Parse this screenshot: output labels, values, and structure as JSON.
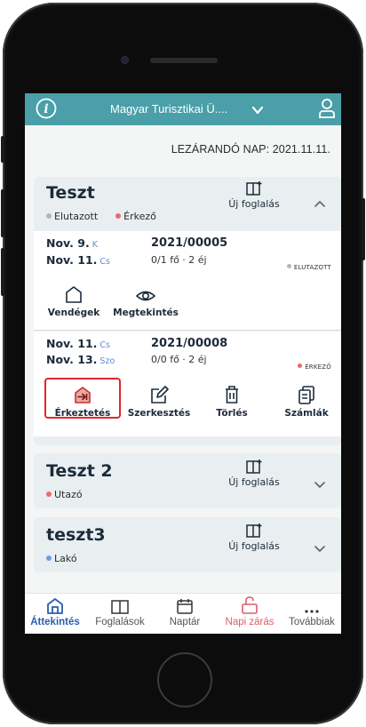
{
  "header": {
    "title": "Magyar Turisztikai Ü....",
    "info_icon": "info-circle-icon",
    "user_icon": "user-icon",
    "accent": "#4a9fa9"
  },
  "close_day": "LEZÁRANDÓ NAP: 2021.11.11.",
  "cards": [
    {
      "title": "Teszt",
      "legend": [
        {
          "label": "Elutazott",
          "color": "#b5b5b5"
        },
        {
          "label": "Érkező",
          "color": "#e76a74"
        }
      ],
      "new_booking": "Új foglalás",
      "expanded": true,
      "bookings": [
        {
          "date1": "Nov. 9.",
          "day1": "K",
          "date2": "Nov. 11.",
          "day2": "Cs",
          "number": "2021/00005",
          "guests": "0/1 fő · 2 éj",
          "status": "ELUTAZOTT",
          "status_color": "#b5b5b5",
          "actions": [
            {
              "label": "Vendégek",
              "icon": "house-icon"
            },
            {
              "label": "Megtekintés",
              "icon": "eye-icon"
            }
          ]
        },
        {
          "date1": "Nov. 11.",
          "day1": "Cs",
          "date2": "Nov. 13.",
          "day2": "Szo",
          "number": "2021/00008",
          "guests": "0/0 fő · 2 éj",
          "status": "ÉRKEZŐ",
          "status_color": "#e76a74",
          "actions": [
            {
              "label": "Érkeztetés",
              "icon": "checkin-house-icon",
              "highlighted": true
            },
            {
              "label": "Szerkesztés",
              "icon": "edit-icon"
            },
            {
              "label": "Törlés",
              "icon": "trash-icon"
            },
            {
              "label": "Számlák",
              "icon": "invoices-icon"
            }
          ]
        }
      ]
    },
    {
      "title": "Teszt 2",
      "legend": [
        {
          "label": "Utazó",
          "color": "#e76a74"
        }
      ],
      "new_booking": "Új foglalás",
      "expanded": false
    },
    {
      "title": "teszt3",
      "legend": [
        {
          "label": "Lakó",
          "color": "#6a9fe0"
        }
      ],
      "new_booking": "Új foglalás",
      "expanded": false
    }
  ],
  "bottom_nav": [
    {
      "label": "Áttekintés",
      "icon": "home-icon",
      "active": true
    },
    {
      "label": "Foglalások",
      "icon": "book-icon"
    },
    {
      "label": "Naptár",
      "icon": "calendar-icon"
    },
    {
      "label": "Napi zárás",
      "icon": "lock-icon",
      "color": "#e05b68"
    },
    {
      "label": "Továbbiak",
      "icon": "more-icon"
    }
  ]
}
